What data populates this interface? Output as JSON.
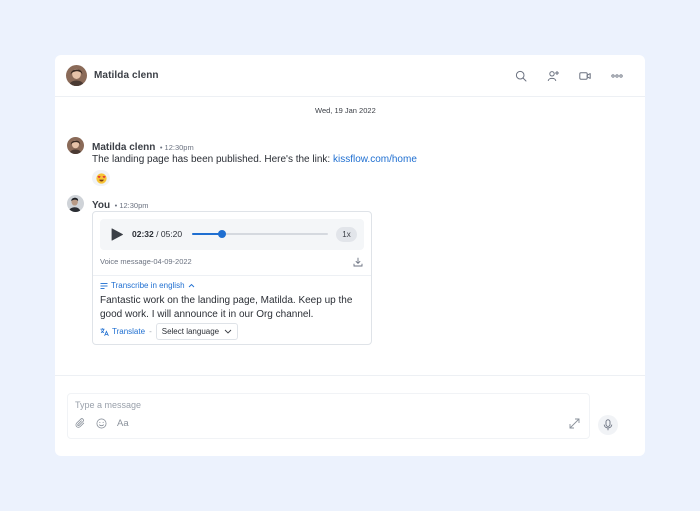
{
  "header": {
    "contact_name": "Matilda clenn",
    "icons": [
      "search-icon",
      "add-user-icon",
      "video-call-icon",
      "more-icon"
    ]
  },
  "date_separator": "Wed, 19 Jan 2022",
  "messages": [
    {
      "sender": "Matilda clenn",
      "time": "12:30pm",
      "text": "The landing page has been published. Here's the link: ",
      "link": "kissflow.com/home",
      "reaction": "heart-eyes-emoji"
    },
    {
      "sender": "You",
      "time": "12:30pm",
      "voice": {
        "current_time": "02:32",
        "separator": " / ",
        "duration": "05:20",
        "progress": 0.2213,
        "speed": "1x",
        "file_name": "Voice message-04-09-2022"
      },
      "transcribe_label": "Transcribe in english",
      "transcript": "Fantastic work on the landing page, Matilda. Keep up the good work. I will announce it in our Org channel.",
      "translate_label": "Translate",
      "translate_separator": "-",
      "language_select": "Select language"
    }
  ],
  "composer": {
    "placeholder": "Type a message",
    "format_label": "Aa"
  },
  "colors": {
    "accent": "#1f6fd1",
    "background": "#ecf2fd",
    "card": "#ffffff"
  }
}
